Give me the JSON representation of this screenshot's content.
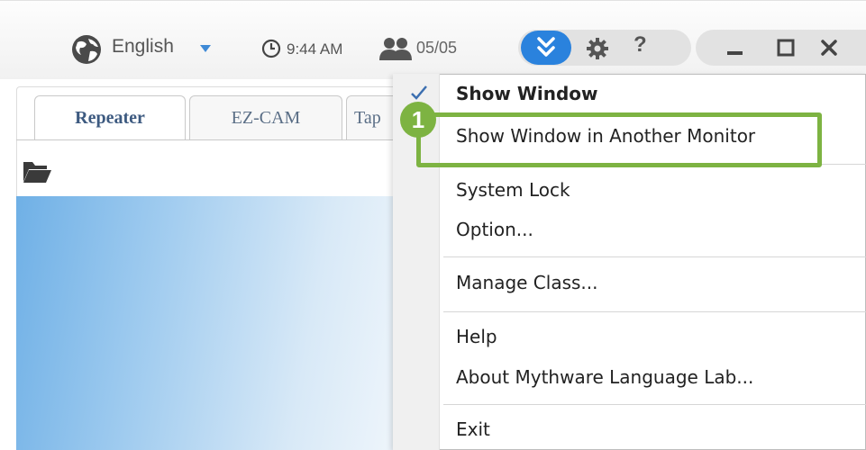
{
  "toolbar": {
    "language": "English",
    "time": "9:44 AM",
    "student_count": "05/05",
    "help_label": "?",
    "icons": [
      "globe-icon",
      "caret-down-icon",
      "clock-icon",
      "students-icon",
      "double-chevron-down-icon",
      "gear-icon",
      "minimize-icon",
      "maximize-icon",
      "close-icon"
    ]
  },
  "tabs": [
    {
      "label": "Repeater",
      "active": true
    },
    {
      "label": "EZ-CAM",
      "active": false
    },
    {
      "label": "Tap",
      "active": false
    }
  ],
  "menu": {
    "items": [
      {
        "label": "Show Window",
        "checked": true
      },
      {
        "label": "Show Window in Another Monitor"
      },
      {
        "label": "System Lock"
      },
      {
        "label": "Option..."
      },
      {
        "label": "Manage Class..."
      },
      {
        "label": "Help"
      },
      {
        "label": "About Mythware Language Lab..."
      },
      {
        "label": "Exit"
      }
    ]
  },
  "annotation": {
    "step": "1",
    "color": "#7db342"
  },
  "colors": {
    "accent": "#2a82dd",
    "highlight": "#7db342"
  }
}
